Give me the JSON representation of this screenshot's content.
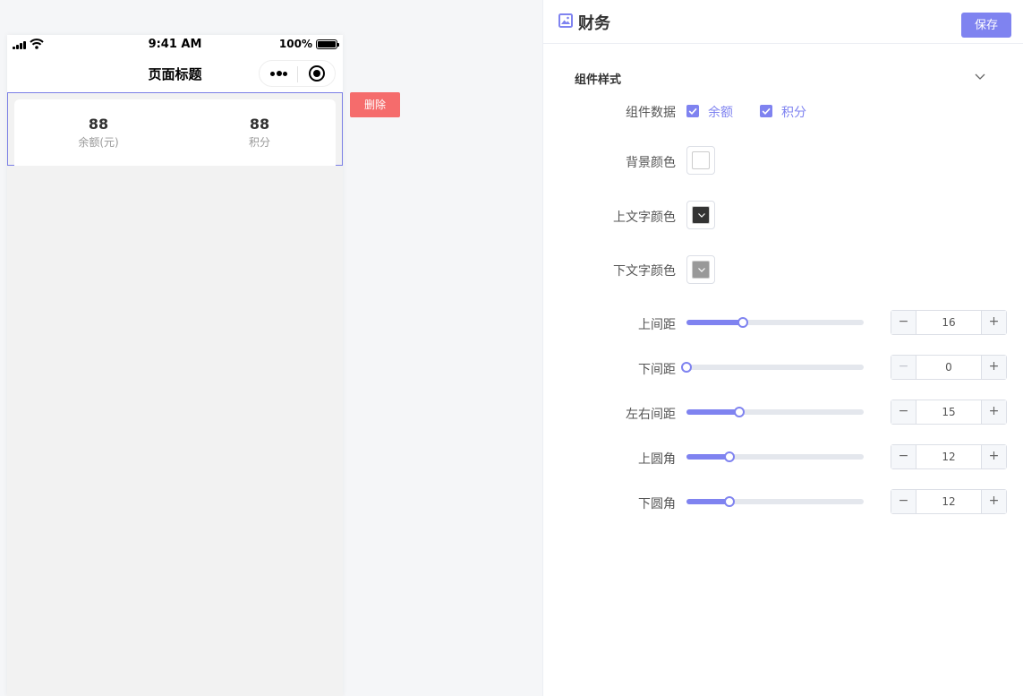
{
  "statusbar": {
    "time": "9:41 AM",
    "battery": "100%"
  },
  "navbar": {
    "title": "页面标题"
  },
  "widget": {
    "stats": [
      {
        "value": "88",
        "label": "余额(元)"
      },
      {
        "value": "88",
        "label": "积分"
      }
    ]
  },
  "delete_label": "删除",
  "panel": {
    "title": "财务",
    "save_label": "保存",
    "section_title": "组件样式",
    "data_row": {
      "label": "组件数据",
      "options": [
        {
          "label": "余额",
          "checked": true
        },
        {
          "label": "积分",
          "checked": true
        }
      ]
    },
    "colors": [
      {
        "label": "背景颜色",
        "value": "#ffffff"
      },
      {
        "label": "上文字颜色",
        "value": "#333333"
      },
      {
        "label": "下文字颜色",
        "value": "#999999"
      }
    ],
    "sliders": [
      {
        "label": "上间距",
        "value": 16,
        "min": 0,
        "max": 50
      },
      {
        "label": "下间距",
        "value": 0,
        "min": 0,
        "max": 50
      },
      {
        "label": "左右间距",
        "value": 15,
        "min": 0,
        "max": 50
      },
      {
        "label": "上圆角",
        "value": 12,
        "min": 0,
        "max": 50
      },
      {
        "label": "下圆角",
        "value": 12,
        "min": 0,
        "max": 50
      }
    ]
  },
  "colors": {
    "accent": "#7f83f0",
    "danger": "#f56c6c",
    "selection_border": "#7b7fe6"
  }
}
